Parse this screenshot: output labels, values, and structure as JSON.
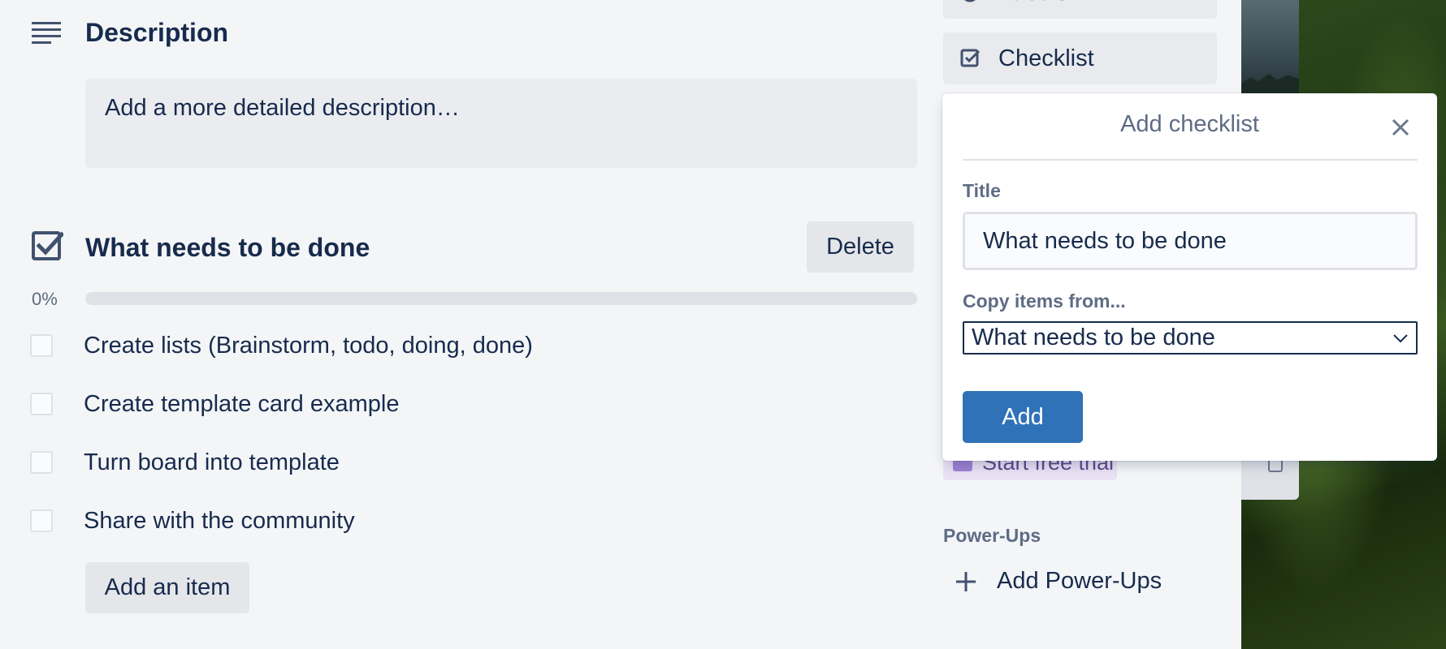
{
  "description": {
    "heading": "Description",
    "placeholder": "Add a more detailed description…"
  },
  "checklist": {
    "title": "What needs to be done",
    "delete_label": "Delete",
    "progress_text": "0%",
    "progress": 0,
    "items": [
      {
        "text": "Create lists (Brainstorm, todo, doing, done)",
        "checked": false
      },
      {
        "text": "Create template card example",
        "checked": false
      },
      {
        "text": "Turn board into template",
        "checked": false
      },
      {
        "text": "Share with the community",
        "checked": false
      }
    ],
    "add_item_label": "Add an item"
  },
  "sidebar": {
    "labels_partial": "Labels",
    "checklist_label": "Checklist",
    "trial_label": "Start free trial",
    "powerups_heading": "Power-Ups",
    "add_powerups_label": "Add Power-Ups"
  },
  "popover": {
    "title": "Add checklist",
    "title_field_label": "Title",
    "title_value": "What needs to be done",
    "copy_label": "Copy items from...",
    "copy_selected": "What needs to be done",
    "add_label": "Add"
  },
  "colors": {
    "accent": "#2f72b8",
    "text": "#172b4d",
    "muted": "#5e6c84",
    "background": "#f4f5f7"
  }
}
